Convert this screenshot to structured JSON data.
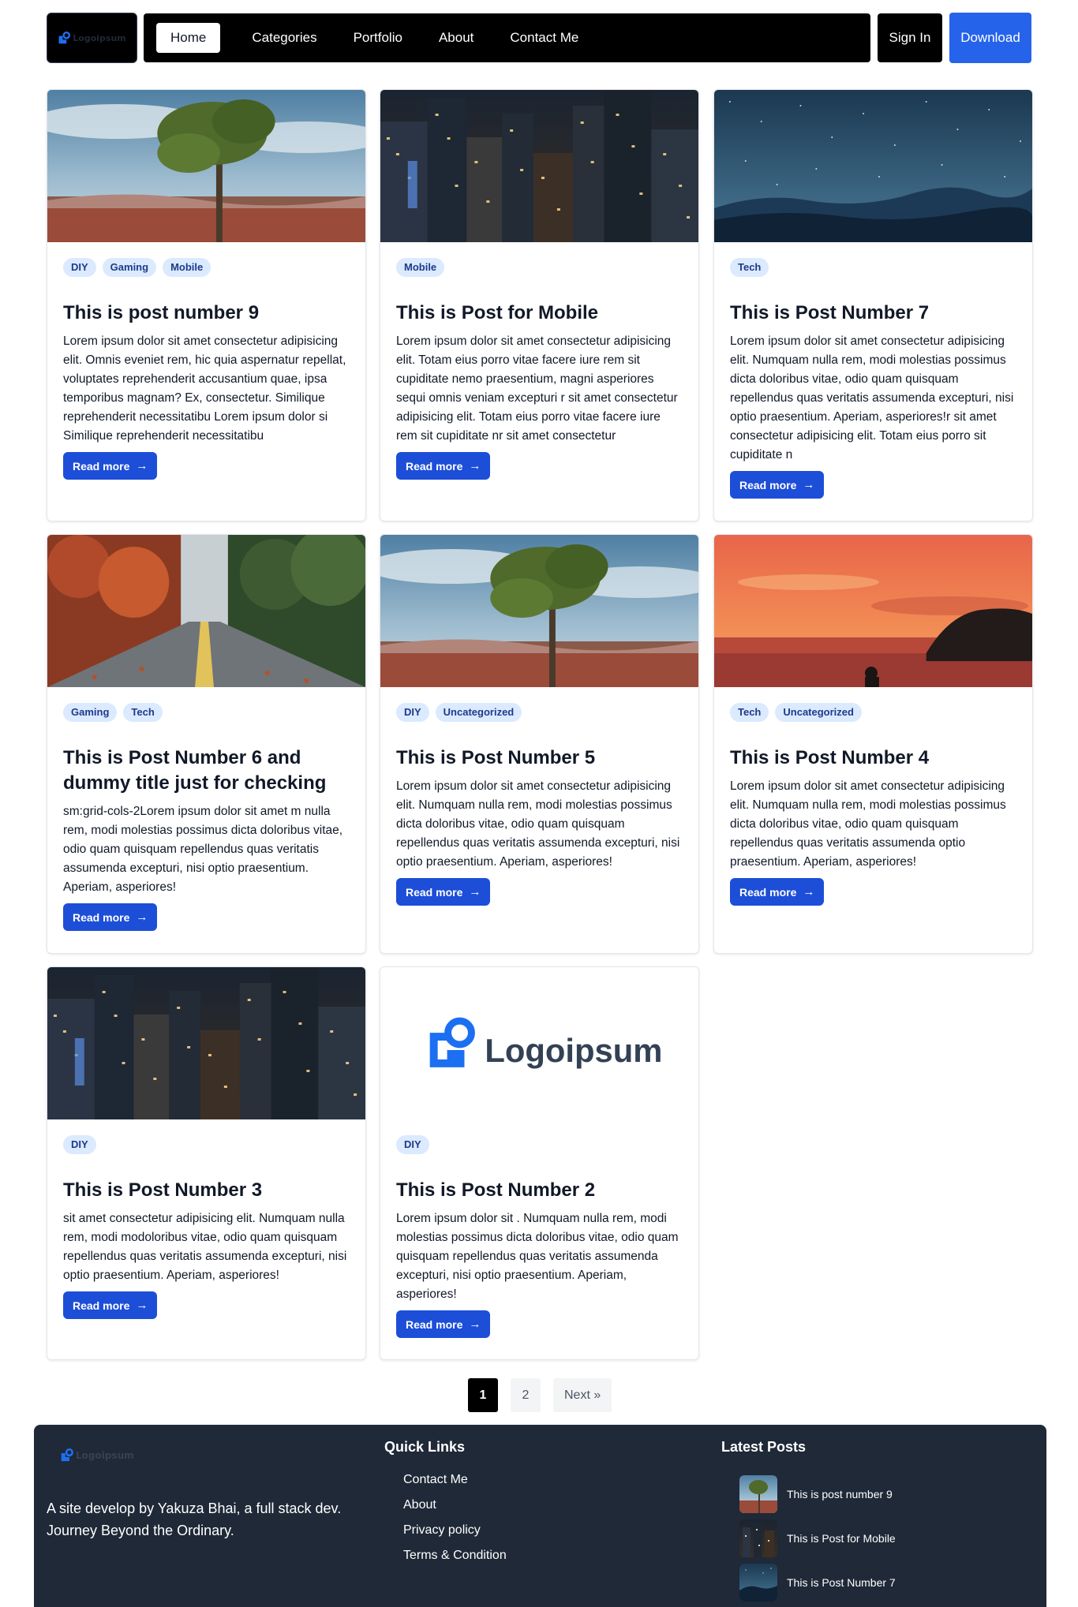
{
  "header": {
    "logo_text": "Logoipsum",
    "nav": [
      "Home",
      "Categories",
      "Portfolio",
      "About",
      "Contact Me"
    ],
    "signin_label": "Sign In",
    "download_label": "Download"
  },
  "posts": [
    {
      "tags": [
        "DIY",
        "Gaming",
        "Mobile"
      ],
      "title": "This is post number 9",
      "excerpt": "Lorem ipsum dolor sit amet consectetur adipisicing elit. Omnis eveniet rem, hic quia aspernatur repellat, voluptates reprehenderit accusantium quae, ipsa temporibus magnam? Ex, consectetur. Similique reprehenderit necessitatibu Lorem ipsum dolor si Similique reprehenderit necessitatibu",
      "read_more": "Read more",
      "image": "tree-canyon"
    },
    {
      "tags": [
        "Mobile"
      ],
      "title": "This is Post for Mobile",
      "excerpt": "Lorem ipsum dolor sit amet consectetur adipisicing elit. Totam eius porro vitae facere iure rem sit cupiditate nemo praesentium, magni asperiores sequi omnis veniam excepturi r sit amet consectetur adipisicing elit. Totam eius porro vitae facere iure rem sit cupiditate nr sit amet consectetur",
      "read_more": "Read more",
      "image": "city-night"
    },
    {
      "tags": [
        "Tech"
      ],
      "title": "This is Post Number 7",
      "excerpt": "Lorem ipsum dolor sit amet consectetur adipisicing elit. Numquam nulla rem, modi molestias possimus dicta doloribus vitae, odio quam quisquam repellendus quas veritatis assumenda excepturi, nisi optio praesentium. Aperiam, asperiores!r sit amet consectetur adipisicing elit. Totam eius porro sit cupiditate n",
      "read_more": "Read more",
      "image": "starry-mountains"
    },
    {
      "tags": [
        "Gaming",
        "Tech"
      ],
      "title": "This is Post Number 6 and dummy title just for checking",
      "excerpt": "sm:grid-cols-2Lorem ipsum dolor sit amet m nulla rem, modi molestias possimus dicta doloribus vitae, odio quam quisquam repellendus quas veritatis assumenda excepturi, nisi optio praesentium. Aperiam, asperiores!",
      "read_more": "Read more",
      "image": "autumn-road"
    },
    {
      "tags": [
        "DIY",
        "Uncategorized"
      ],
      "title": "This is Post Number 5",
      "excerpt": "Lorem ipsum dolor sit amet consectetur adipisicing elit. Numquam nulla rem, modi molestias possimus dicta doloribus vitae, odio quam quisquam repellendus quas veritatis assumenda excepturi, nisi optio praesentium. Aperiam, asperiores!",
      "read_more": "Read more",
      "image": "tree-canyon"
    },
    {
      "tags": [
        "Tech",
        "Uncategorized"
      ],
      "title": "This is Post Number 4",
      "excerpt": "Lorem ipsum dolor sit amet consectetur adipisicing elit. Numquam nulla rem, modi molestias possimus dicta doloribus vitae, odio quam quisquam repellendus quas veritatis assumenda optio praesentium. Aperiam, asperiores!",
      "read_more": "Read more",
      "image": "sunset-sea"
    },
    {
      "tags": [
        "DIY"
      ],
      "title": "This is Post Number 3",
      "excerpt": "sit amet consectetur adipisicing elit. Numquam nulla rem, modi modoloribus vitae, odio quam quisquam repellendus quas veritatis assumenda excepturi, nisi optio praesentium. Aperiam, asperiores!",
      "read_more": "Read more",
      "image": "city-night"
    },
    {
      "tags": [
        "DIY"
      ],
      "title": "This is Post Number 2",
      "excerpt": "Lorem ipsum dolor sit . Numquam nulla rem, modi molestias possimus dicta doloribus vitae, odio quam quisquam repellendus quas veritatis assumenda excepturi, nisi optio praesentium. Aperiam, asperiores!",
      "read_more": "Read more",
      "image": "logo",
      "logo_text": "Logoipsum"
    }
  ],
  "pagination": {
    "pages": [
      "1",
      "2"
    ],
    "current": "1",
    "next_label": "Next »"
  },
  "footer": {
    "logo_text": "Logoipsum",
    "description": "A site develop by Yakuza Bhai, a full stack dev. Journey Beyond the Ordinary.",
    "quick_links_heading": "Quick Links",
    "quick_links": [
      "Contact Me",
      "About",
      "Privacy policy",
      "Terms & Condition"
    ],
    "latest_heading": "Latest Posts",
    "latest_posts": [
      {
        "title": "This is post number 9",
        "image": "tree-canyon"
      },
      {
        "title": "This is Post for Mobile",
        "image": "city-night"
      },
      {
        "title": "This is Post Number 7",
        "image": "starry-mountains"
      }
    ]
  },
  "colors": {
    "accent": "#2563eb",
    "button": "#1d4ed8",
    "tag_bg": "#dbeafe",
    "tag_text": "#1e3a8a",
    "footer_bg": "#1f2937"
  }
}
